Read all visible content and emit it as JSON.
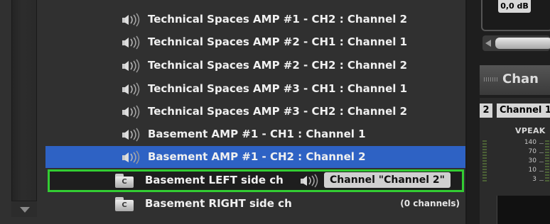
{
  "list": {
    "rows": [
      {
        "label": "Technical Spaces AMP #1 - CH2 : Channel 2"
      },
      {
        "label": "Technical Spaces AMP #2 - CH1 : Channel 1"
      },
      {
        "label": "Technical Spaces AMP #2 - CH2 : Channel 2"
      },
      {
        "label": "Technical Spaces AMP #3 - CH1 : Channel 1"
      },
      {
        "label": "Technical Spaces AMP #3 - CH2 : Channel 2"
      },
      {
        "label": "Basement AMP #1 - CH1 : Channel 1"
      },
      {
        "label": "Basement AMP #1 - CH2 : Channel 2"
      }
    ],
    "folders": [
      {
        "icon_letter": "C",
        "label": "Basement LEFT side ch",
        "drop_tag": "Channel \"Channel 2\""
      },
      {
        "icon_letter": "C",
        "label": "Basement RIGHT side ch",
        "count": "(0 channels)"
      }
    ]
  },
  "right_panel": {
    "level": "0,0 dB",
    "channels_header": "Chan",
    "channel_number": "2",
    "channel_tab": "Channel 1",
    "vpeak_label": "VPEAK",
    "scale": [
      "140",
      "70",
      "30",
      "10",
      "3"
    ]
  },
  "colors": {
    "selection": "#2e62c4",
    "drop_target_outline": "#33cc33",
    "background": "#303030"
  }
}
